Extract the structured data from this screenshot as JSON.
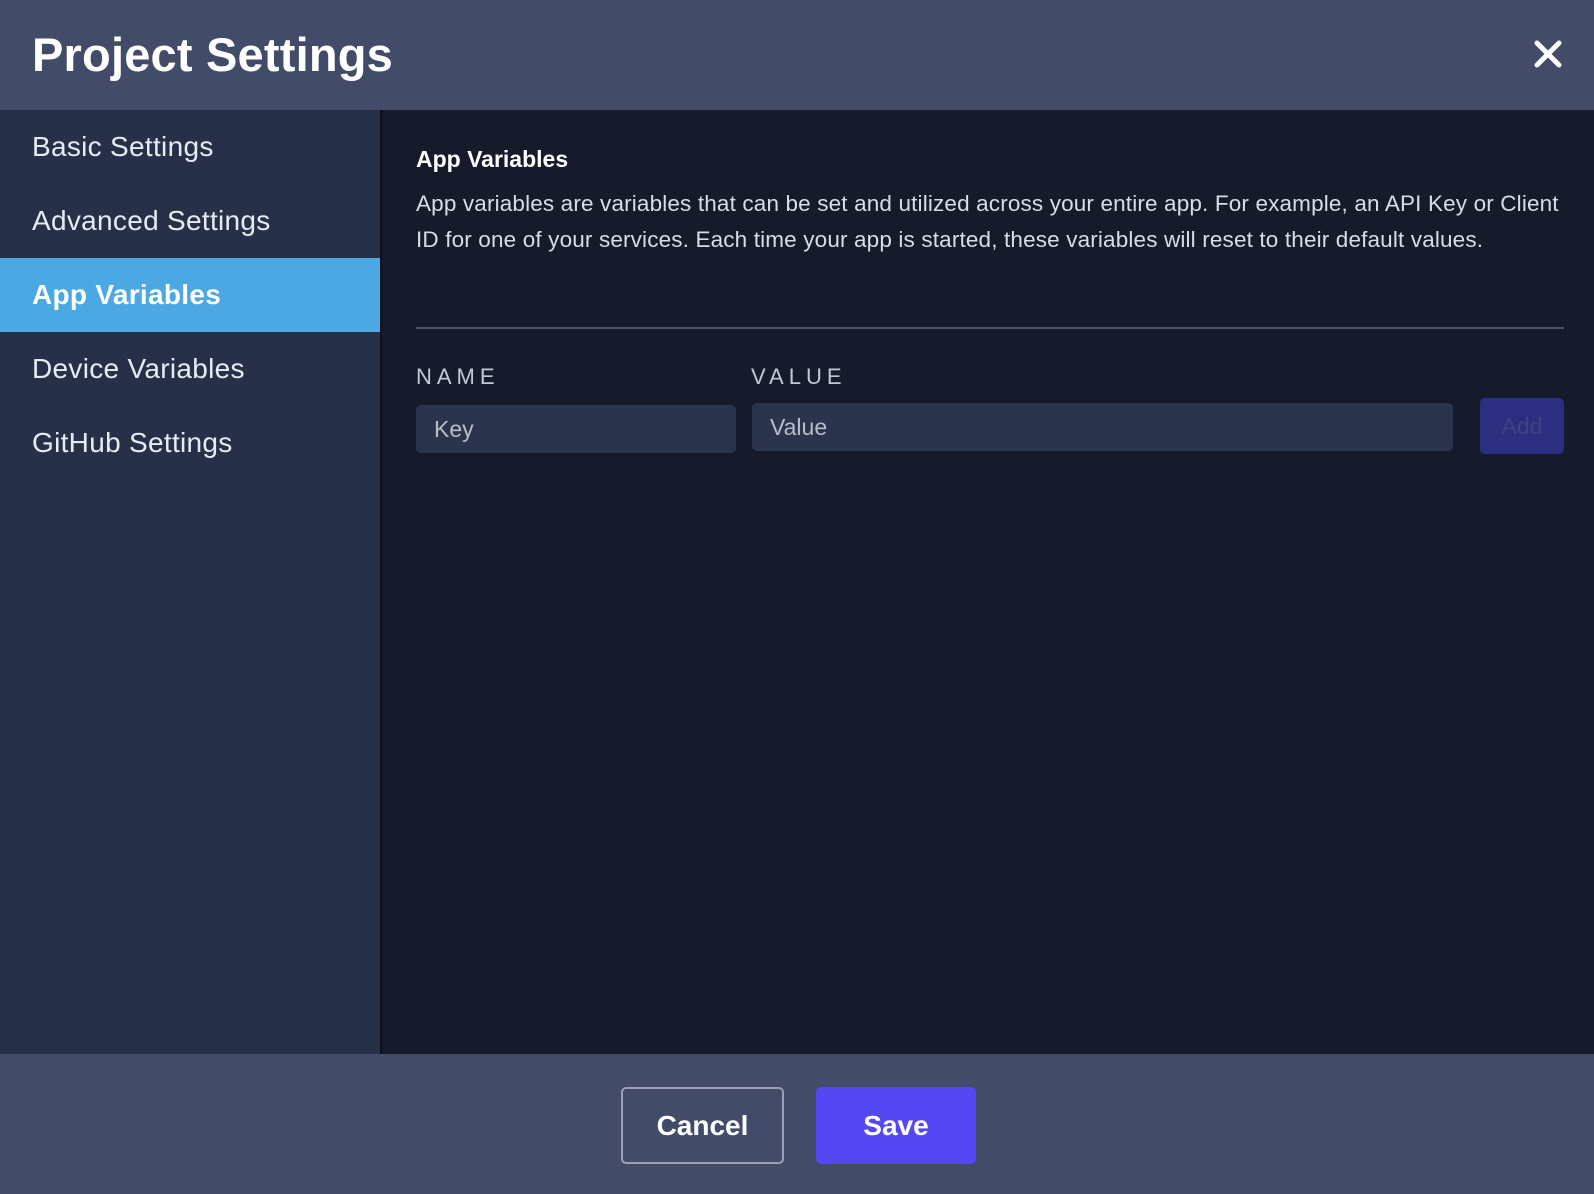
{
  "dialog": {
    "title": "Project Settings",
    "close_icon": "close-icon"
  },
  "sidebar": {
    "items": [
      {
        "label": "Basic Settings",
        "active": false
      },
      {
        "label": "Advanced Settings",
        "active": false
      },
      {
        "label": "App Variables",
        "active": true
      },
      {
        "label": "Device Variables",
        "active": false
      },
      {
        "label": "GitHub Settings",
        "active": false
      }
    ]
  },
  "main": {
    "title": "App Variables",
    "description": "App variables are variables that can be set and utilized across your entire app. For example, an API Key or Client ID for one of your services. Each time your app is started, these variables will reset to their default values.",
    "name_label": "NAME",
    "value_label": "VALUE",
    "name_input": {
      "value": "",
      "placeholder": "Key"
    },
    "value_input": {
      "value": "",
      "placeholder": "Value"
    },
    "add_label": "Add"
  },
  "footer": {
    "cancel_label": "Cancel",
    "save_label": "Save"
  },
  "colors": {
    "header_bg": "#424c69",
    "sidebar_bg": "#263049",
    "main_bg": "#151b2b",
    "active_item": "#4ba8e3",
    "save_button": "#5548f2",
    "add_button_disabled": "#2c2f80"
  }
}
